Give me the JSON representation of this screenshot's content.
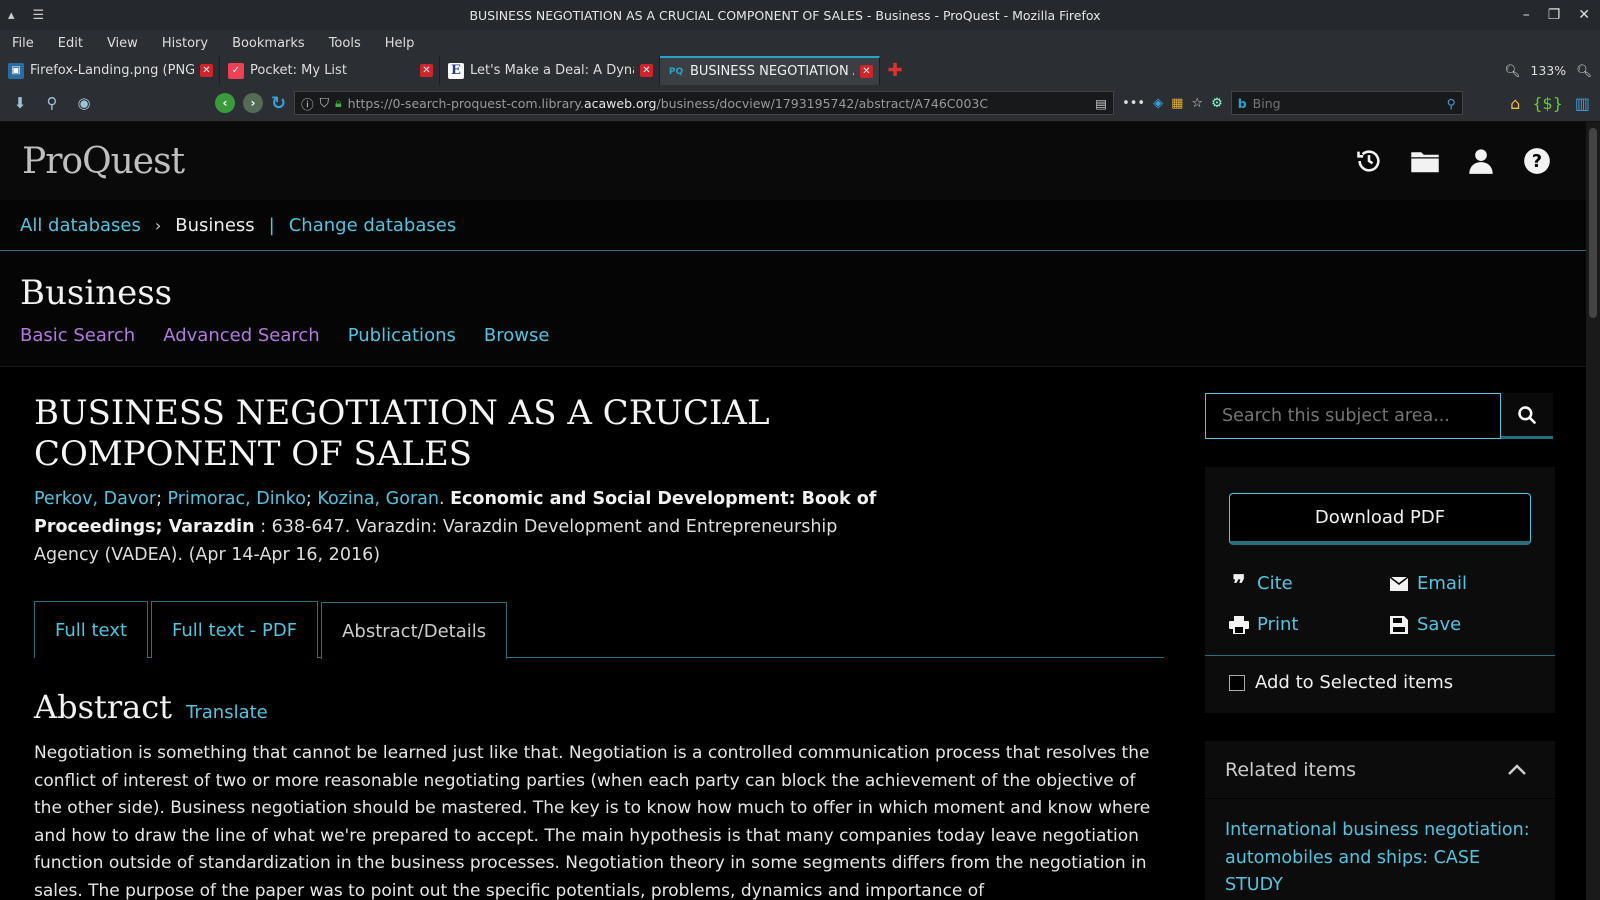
{
  "window": {
    "title": "BUSINESS NEGOTIATION AS A CRUCIAL COMPONENT OF SALES - Business - ProQuest - Mozilla Firefox"
  },
  "menu": [
    "File",
    "Edit",
    "View",
    "History",
    "Bookmarks",
    "Tools",
    "Help"
  ],
  "tabs": [
    {
      "label": "Firefox-Landing.png (PNG Im",
      "icon": "image-file-icon"
    },
    {
      "label": "Pocket: My List",
      "icon": "pocket-icon"
    },
    {
      "label": "Let's Make a Deal: A Dynam",
      "icon": "e-letter-icon"
    },
    {
      "label": "BUSINESS NEGOTIATION A",
      "icon": "proquest-favicon"
    }
  ],
  "zoom": "133%",
  "urlbar": {
    "prefix": "https://0-search-proquest-com.library.",
    "domain": "acaweb.org",
    "path": "/business/docview/1793195742/abstract/A746C003C"
  },
  "search_engine": {
    "placeholder": "Bing"
  },
  "proquest": {
    "logo": "ProQuest",
    "breadcrumb": {
      "all": "All databases",
      "current": "Business",
      "change": "Change databases"
    },
    "subject": "Business",
    "subject_nav": {
      "basic": "Basic Search",
      "advanced": "Advanced Search",
      "publications": "Publications",
      "browse": "Browse"
    }
  },
  "document": {
    "title": "BUSINESS NEGOTIATION AS A CRUCIAL COMPONENT OF SALES",
    "authors": [
      "Perkov, Davor",
      "Primorac, Dinko",
      "Kozina, Goran"
    ],
    "source": "Economic and Social Development: Book of Proceedings; Varazdin",
    "citation": ": 638-647. Varazdin: Varazdin Development and Entrepreneurship Agency (VADEA). (Apr 14-Apr 16, 2016)",
    "tabs": {
      "full_text": "Full text",
      "full_text_pdf": "Full text - PDF",
      "abstract_details": "Abstract/Details"
    },
    "abstract_heading": "Abstract",
    "translate": "Translate",
    "abstract": "Negotiation is something that cannot be learned just like that. Negotiation is a controlled communication process that resolves the conflict of interest of two or more reasonable negotiating parties (when each party can block the achievement of the objective of the other side). Business negotiation should be mastered. The key is to know how much to offer in which moment and know where and how to draw the line of what we're prepared to accept. The main hypothesis is that many companies today leave negotiation function outside of standardization in the business processes. Negotiation theory in some segments differs from the negotiation in sales. The purpose of the paper was to point out the specific potentials, problems, dynamics and importance of"
  },
  "sidebar": {
    "search_placeholder": "Search this subject area...",
    "download": "Download PDF",
    "cite": "Cite",
    "email": "Email",
    "print": "Print",
    "save": "Save",
    "add_selected": "Add to Selected items",
    "related_heading": "Related items",
    "related_first": "International business negotiation: automobiles and ships: CASE STUDY"
  },
  "colors": {
    "link": "#4fc6e0",
    "visited": "#b27be0",
    "accent_border": "#2a6e80",
    "close_red": "#d2232a"
  }
}
